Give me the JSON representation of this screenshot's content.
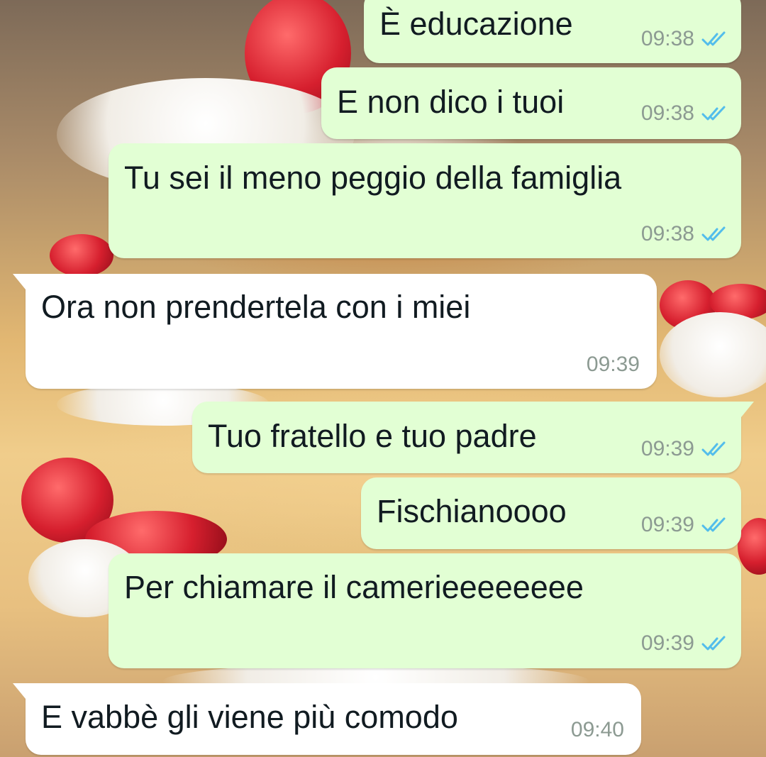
{
  "colors": {
    "outgoing_bubble": "#e2ffd4",
    "incoming_bubble": "#ffffff",
    "read_tick": "#53bdeb",
    "timestamp": "#8c9a92",
    "text": "#111b21"
  },
  "messages": [
    {
      "direction": "out",
      "text": "È educazione",
      "time": "09:38",
      "status_icon": "double-check-read-icon"
    },
    {
      "direction": "out",
      "text": "E non dico i tuoi",
      "time": "09:38",
      "status_icon": "double-check-read-icon"
    },
    {
      "direction": "out",
      "text": "Tu sei il meno peggio della famiglia",
      "time": "09:38",
      "status_icon": "double-check-read-icon"
    },
    {
      "direction": "in",
      "text": "Ora non prendertela con i miei",
      "time": "09:39"
    },
    {
      "direction": "out",
      "text": "Tuo fratello e tuo padre",
      "time": "09:39",
      "status_icon": "double-check-read-icon"
    },
    {
      "direction": "out",
      "text": "Fischianoooo",
      "time": "09:39",
      "status_icon": "double-check-read-icon"
    },
    {
      "direction": "out",
      "text": "Per chiamare il camerieeeeeeee",
      "time": "09:39",
      "status_icon": "double-check-read-icon"
    },
    {
      "direction": "in",
      "text": "E vabbè gli viene più comodo",
      "time": "09:40"
    }
  ]
}
